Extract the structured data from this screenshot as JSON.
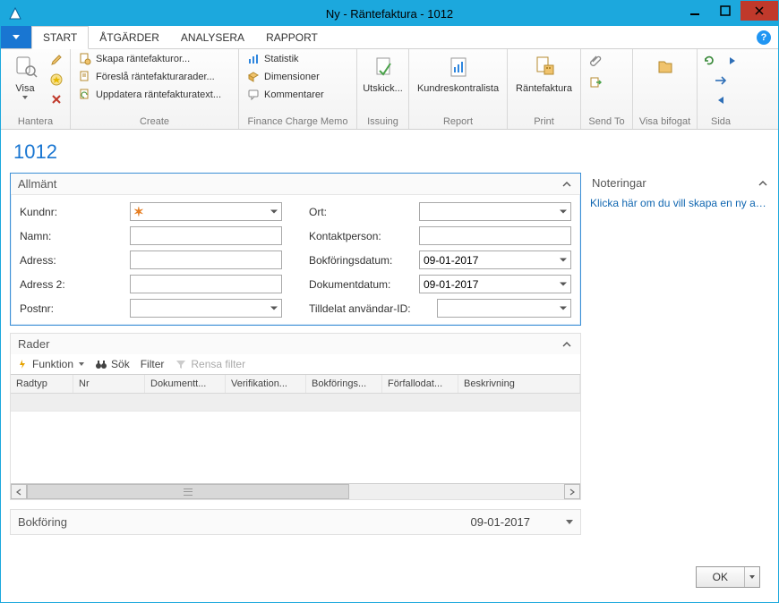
{
  "window": {
    "title": "Ny - Räntefaktura - 1012"
  },
  "tabs": {
    "file": "",
    "items": [
      "START",
      "ÅTGÄRDER",
      "ANALYSERA",
      "RAPPORT"
    ],
    "active": 0
  },
  "ribbon": {
    "hantera": {
      "label": "Hantera",
      "visa": "Visa"
    },
    "create": {
      "label": "Create",
      "skapa": "Skapa räntefakturor...",
      "foresla": "Föreslå räntefakturarader...",
      "uppdatera": "Uppdatera räntefakturatext..."
    },
    "fcm": {
      "label": "Finance Charge Memo",
      "statistik": "Statistik",
      "dimensioner": "Dimensioner",
      "kommentarer": "Kommentarer"
    },
    "issuing": {
      "label": "Issuing",
      "utskick": "Utskick..."
    },
    "report": {
      "label": "Report",
      "kund": "Kundreskontralista"
    },
    "print": {
      "label": "Print",
      "rantefaktura": "Räntefaktura"
    },
    "sendto": {
      "label": "Send To"
    },
    "visa_bifogat": {
      "label": "Visa bifogat"
    },
    "sida": {
      "label": "Sida"
    }
  },
  "page": {
    "title": "1012"
  },
  "allmant": {
    "title": "Allmänt",
    "left": {
      "kundnr": {
        "label": "Kundnr:",
        "value": ""
      },
      "namn": {
        "label": "Namn:",
        "value": ""
      },
      "adress": {
        "label": "Adress:",
        "value": ""
      },
      "adress2": {
        "label": "Adress 2:",
        "value": ""
      },
      "postnr": {
        "label": "Postnr:",
        "value": ""
      }
    },
    "right": {
      "ort": {
        "label": "Ort:",
        "value": ""
      },
      "kontakt": {
        "label": "Kontaktperson:",
        "value": ""
      },
      "bokforingsdatum": {
        "label": "Bokföringsdatum:",
        "value": "09-01-2017"
      },
      "dokumentdatum": {
        "label": "Dokumentdatum:",
        "value": "09-01-2017"
      },
      "tilldelat": {
        "label": "Tilldelat användar-ID:",
        "value": ""
      }
    }
  },
  "rader": {
    "title": "Rader",
    "toolbar": {
      "funktion": "Funktion",
      "sok": "Sök",
      "filter": "Filter",
      "rensa": "Rensa filter"
    },
    "columns": [
      "Radtyp",
      "Nr",
      "Dokumentt...",
      "Verifikation...",
      "Bokförings...",
      "Förfallodat...",
      "Beskrivning"
    ]
  },
  "bokforing": {
    "title": "Bokföring",
    "value": "09-01-2017"
  },
  "noteringar": {
    "title": "Noteringar",
    "link": "Klicka här om du vill skapa en ny an..."
  },
  "footer": {
    "ok": "OK"
  }
}
